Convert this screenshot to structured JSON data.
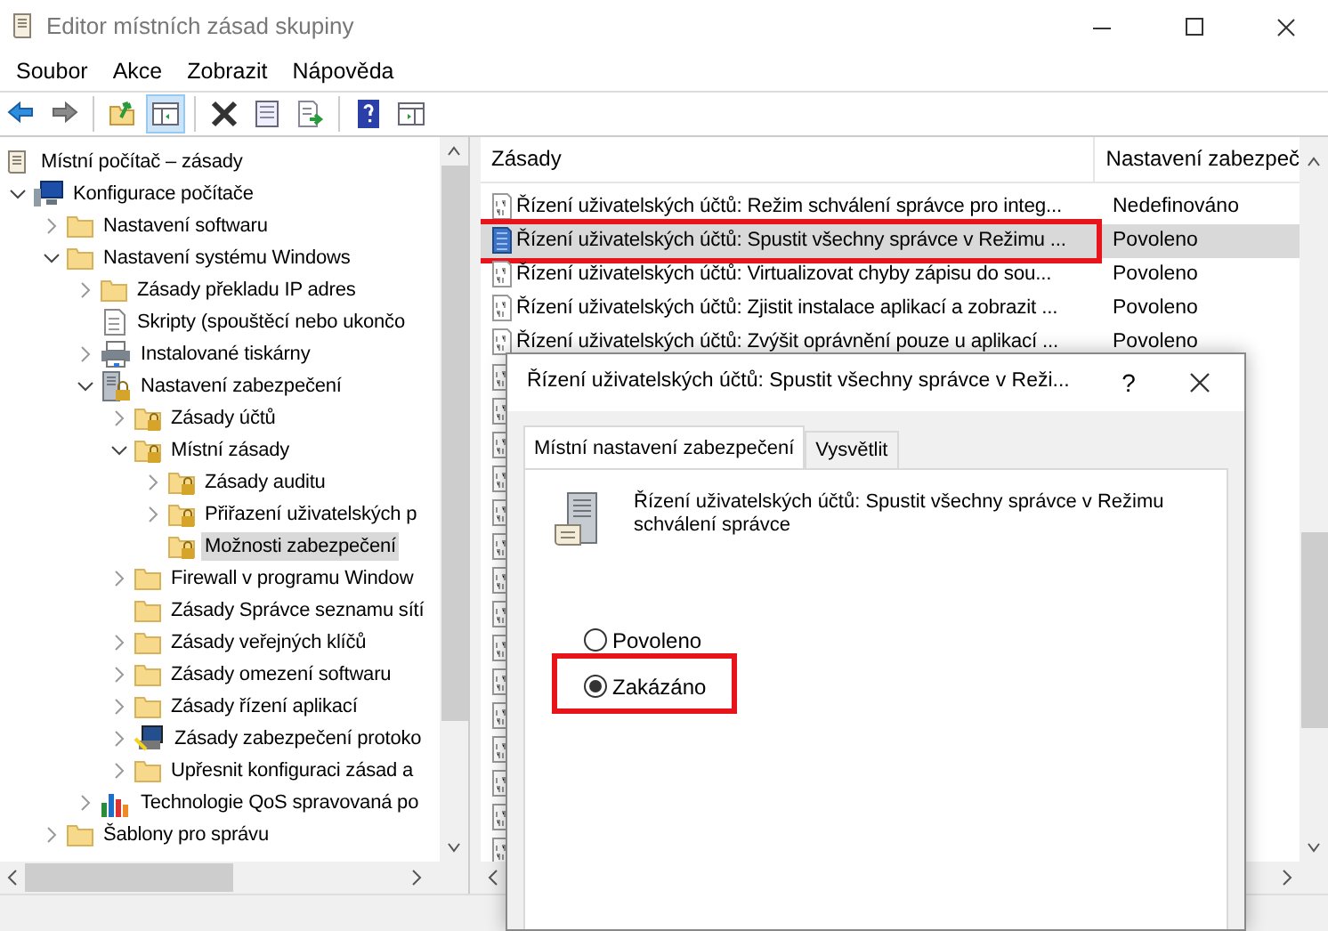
{
  "window": {
    "title": "Editor místních zásad skupiny"
  },
  "menu": [
    "Soubor",
    "Akce",
    "Zobrazit",
    "Nápověda"
  ],
  "toolbar": [
    {
      "kind": "back",
      "pressed": false
    },
    {
      "kind": "forward",
      "pressed": false
    },
    {
      "kind": "sep"
    },
    {
      "kind": "up",
      "pressed": false
    },
    {
      "kind": "tree",
      "pressed": true
    },
    {
      "kind": "sep"
    },
    {
      "kind": "delete",
      "pressed": false
    },
    {
      "kind": "properties",
      "pressed": false
    },
    {
      "kind": "export",
      "pressed": false
    },
    {
      "kind": "sep"
    },
    {
      "kind": "help",
      "pressed": false
    },
    {
      "kind": "actionpane",
      "pressed": false
    }
  ],
  "tree": [
    {
      "label": "Místní počítač – zásady",
      "kind": "scroll",
      "selected": false,
      "children": [
        {
          "label": "Konfigurace počítače",
          "kind": "computer",
          "expanded": true,
          "selected": false,
          "children": [
            {
              "label": "Nastavení softwaru",
              "kind": "folder",
              "expanded": false,
              "selected": false
            },
            {
              "label": "Nastavení systému Windows",
              "kind": "folder",
              "expanded": true,
              "selected": false,
              "children": [
                {
                  "label": "Zásady překladu IP adres",
                  "kind": "folder",
                  "expanded": false,
                  "selected": false
                },
                {
                  "label": "Skripty (spouštěcí nebo ukončo",
                  "kind": "script",
                  "selected": false
                },
                {
                  "label": "Instalované tiskárny",
                  "kind": "printer",
                  "expanded": false,
                  "selected": false
                },
                {
                  "label": "Nastavení zabezpečení",
                  "kind": "security",
                  "expanded": true,
                  "selected": false,
                  "children": [
                    {
                      "label": "Zásady účtů",
                      "kind": "lockfolder",
                      "expanded": false,
                      "selected": false
                    },
                    {
                      "label": "Místní zásady",
                      "kind": "lockfolder",
                      "expanded": true,
                      "selected": false,
                      "children": [
                        {
                          "label": "Zásady auditu",
                          "kind": "lockfolder",
                          "expanded": false,
                          "selected": false
                        },
                        {
                          "label": "Přiřazení uživatelských p",
                          "kind": "lockfolder",
                          "expanded": false,
                          "selected": false
                        },
                        {
                          "label": "Možnosti zabezpečení",
                          "kind": "lockfolder",
                          "selected": true
                        }
                      ]
                    },
                    {
                      "label": "Firewall v programu Window",
                      "kind": "folder",
                      "expanded": false,
                      "selected": false
                    },
                    {
                      "label": "Zásady Správce seznamu sítí",
                      "kind": "folder",
                      "selected": false
                    },
                    {
                      "label": "Zásady veřejných klíčů",
                      "kind": "folder",
                      "expanded": false,
                      "selected": false
                    },
                    {
                      "label": "Zásady omezení softwaru",
                      "kind": "folder",
                      "expanded": false,
                      "selected": false
                    },
                    {
                      "label": "Zásady řízení aplikací",
                      "kind": "folder",
                      "expanded": false,
                      "selected": false
                    },
                    {
                      "label": "Zásady zabezpečení protoko",
                      "kind": "network",
                      "expanded": false,
                      "selected": false
                    },
                    {
                      "label": "Upřesnit konfiguraci zásad a",
                      "kind": "folder",
                      "expanded": false,
                      "selected": false
                    }
                  ]
                },
                {
                  "label": "Technologie QoS spravovaná po",
                  "kind": "chart",
                  "expanded": false,
                  "selected": false
                }
              ]
            },
            {
              "label": "Šablony pro správu",
              "kind": "folder",
              "expanded": false,
              "selected": false
            }
          ]
        }
      ]
    }
  ],
  "list": {
    "columns": [
      "Zásady",
      "Nastavení zabezpeč"
    ],
    "rows": [
      {
        "kind": "row",
        "policy": "Řízení uživatelských účtů: Režim schválení správce pro integ...",
        "setting": "Nedefinováno",
        "selected": false,
        "highlighted": false
      },
      {
        "kind": "row",
        "policy": "Řízení uživatelských účtů: Spustit všechny správce v Režimu ...",
        "setting": "Povoleno",
        "selected": true,
        "highlighted": true
      },
      {
        "kind": "row",
        "policy": "Řízení uživatelských účtů: Virtualizovat chyby zápisu do sou...",
        "setting": "Povoleno",
        "selected": false,
        "highlighted": false
      },
      {
        "kind": "row",
        "policy": "Řízení uživatelských účtů: Zjistit instalace aplikací a zobrazit ...",
        "setting": "Povoleno",
        "selected": false,
        "highlighted": false
      },
      {
        "kind": "row",
        "policy": "Řízení uživatelských účtů: Zvýšit oprávnění pouze u aplikací ...",
        "setting": "Povoleno",
        "selected": false,
        "highlighted": false
      },
      {
        "kind": "covered"
      },
      {
        "kind": "covered"
      },
      {
        "kind": "covered"
      },
      {
        "kind": "covered"
      },
      {
        "kind": "covered"
      },
      {
        "kind": "covered"
      },
      {
        "kind": "covered"
      },
      {
        "kind": "covered"
      },
      {
        "kind": "covered"
      },
      {
        "kind": "covered"
      },
      {
        "kind": "covered"
      },
      {
        "kind": "covered"
      },
      {
        "kind": "covered"
      },
      {
        "kind": "covered"
      },
      {
        "kind": "covered"
      }
    ]
  },
  "dialog": {
    "title": "Řízení uživatelských účtů: Spustit všechny správce v Reži...",
    "help": "?",
    "tabs": [
      {
        "label": "Místní nastavení zabezpečení",
        "selected": true
      },
      {
        "label": "Vysvětlit",
        "selected": false
      }
    ],
    "description": "Řízení uživatelských účtů: Spustit všechny správce v Režimu schválení správce",
    "options": [
      {
        "label": "Povoleno",
        "checked": false,
        "highlighted": false
      },
      {
        "label": "Zakázáno",
        "checked": true,
        "highlighted": true
      }
    ]
  }
}
